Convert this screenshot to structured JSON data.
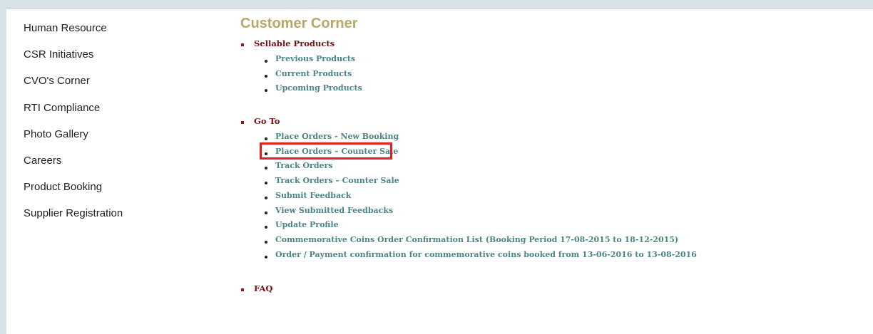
{
  "sidebar": {
    "items": [
      {
        "label": "Human Resource"
      },
      {
        "label": "CSR Initiatives"
      },
      {
        "label": "CVO's Corner"
      },
      {
        "label": "RTI Compliance"
      },
      {
        "label": "Photo Gallery"
      },
      {
        "label": "Careers"
      },
      {
        "label": "Product Booking"
      },
      {
        "label": "Supplier Registration"
      }
    ]
  },
  "main": {
    "title": "Customer Corner",
    "sections": [
      {
        "heading": "Sellable Products",
        "links": [
          "Previous Products",
          "Current Products",
          "Upcoming Products"
        ]
      },
      {
        "heading": "Go To",
        "links": [
          "Place Orders - New Booking",
          "Place Orders – Counter Sale",
          "Track Orders",
          "Track Orders – Counter Sale",
          "Submit Feedback",
          "View Submitted Feedbacks",
          "Update Profile",
          "Commemorative Coins Order Confirmation List (Booking Period 17-08-2015 to 18-12-2015)",
          "Order / Payment confirmation for commemorative coins booked from 13-06-2016 to 13-08-2016"
        ]
      },
      {
        "heading": "FAQ",
        "links": []
      }
    ]
  },
  "colors": {
    "background": "#d7e3e6",
    "title": "#b5a86a",
    "section_heading": "#7a0e0e",
    "link": "#4b8585",
    "highlight_box": "#e0201e"
  }
}
